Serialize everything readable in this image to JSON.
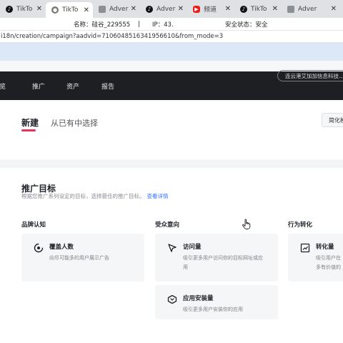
{
  "browser": {
    "tabs": [
      {
        "icon": "tiktok-icon",
        "label": "TikTo",
        "active": false
      },
      {
        "icon": "chrome-icon",
        "label": "TikTo",
        "active": true
      },
      {
        "icon": "adver-icon",
        "label": "Adver",
        "active": false
      },
      {
        "icon": "tiktok-icon",
        "label": "Adver",
        "active": false
      },
      {
        "icon": "youtube-icon",
        "label": "频道",
        "active": false
      },
      {
        "icon": "tiktok-icon",
        "label": "TikTo",
        "active": false
      },
      {
        "icon": "adver-icon",
        "label": "Adver",
        "active": false
      }
    ],
    "close_glyph": "✕"
  },
  "infobar": {
    "name": "名称：硅谷_229555",
    "divider": "|",
    "ip": "IP：43.",
    "security": "安全状态：安全"
  },
  "address": {
    "url": "i18n/creation/campaign?aadvid=7106048516341956610&from_mode=3"
  },
  "topnav": {
    "items": [
      "概览",
      "推广",
      "资产",
      "报告"
    ],
    "account_button": "连云港艾加加信息科技..."
  },
  "creation_tabs": {
    "new": "新建",
    "existing": "从已有中选择",
    "simple_mode": "简化模式"
  },
  "objective": {
    "title": "推广目标",
    "subtitle": "根据您推广系列设定的目标，选择最佳的推广目标。",
    "link": "查看详情",
    "columns": [
      {
        "title": "品牌认知"
      },
      {
        "title": "受众意向"
      },
      {
        "title": "行为转化"
      }
    ],
    "options": {
      "reach": {
        "name": "覆盖人数",
        "desc": "向尽可能多的用户展示广告"
      },
      "traffic": {
        "name": "访问量",
        "desc1": "吸引更多用户访问你的目标网址或应",
        "desc2": "用"
      },
      "app_install": {
        "name": "应用安装量",
        "desc": "吸引更多用户安装你的应用"
      },
      "conversion": {
        "name": "转化量",
        "desc1": "吸引用户在",
        "desc2": "多有价值的"
      }
    }
  },
  "colors": {
    "nav_bg": "#1e1f22",
    "accent": "#e8345a",
    "link": "#3370ff"
  }
}
